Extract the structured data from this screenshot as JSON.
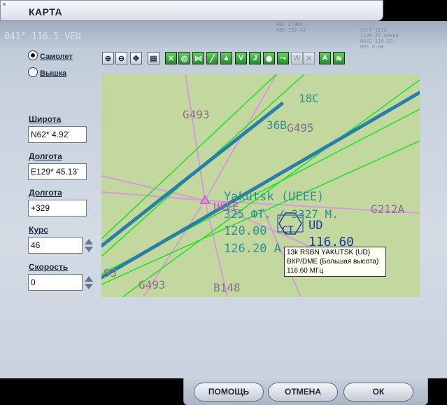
{
  "window": {
    "title": "КАРТА"
  },
  "header_ghost": {
    "left": "041° 116.5 VEN",
    "mid": "ADF 2 MHz\nOBS 132 42",
    "right": "Ctrl 1112\n1125 75 SPEED\nNAV2 110.50\nOBS 0.00"
  },
  "mode": {
    "options": [
      "Самолет",
      "Вышка"
    ],
    "selected": "Самолет"
  },
  "fields": {
    "lat": {
      "label": "Широта",
      "value": "N62* 4.92'"
    },
    "lon": {
      "label": "Долгота",
      "value": "E129* 45.13'"
    },
    "alt": {
      "label": "Долгота",
      "value": "+329"
    },
    "heading": {
      "label": "Курс",
      "value": "46"
    },
    "speed": {
      "label": "Скорость",
      "value": "0"
    }
  },
  "toolbar": [
    "zoom-in",
    "zoom-out",
    "center",
    "print",
    "vor",
    "ndb",
    "ils",
    "airways-low",
    "airways-high",
    "v",
    "j",
    "waypoints",
    "airports",
    "weather",
    "atis",
    "terrain"
  ],
  "map": {
    "labels": {
      "airway_1": "G493",
      "airway_2": "G495",
      "airway_3": "G212A",
      "airway_4": "G493",
      "airway_5": "B148",
      "runway_a": "18C",
      "runway_b": "36B",
      "num_left": "93",
      "airport_name": "Yakutsk (UEEE)",
      "airport_code": "UEEE",
      "elev": "325  ФТ.  / 3327  М.",
      "freq_1": "120.00",
      "freq_2": "126.20  A",
      "vor_code": "UD",
      "vor_freq": "116.60",
      "vor_ct": "CT"
    },
    "tooltip": [
      "13k RSBN YAKUTSK (UD)",
      "ВКР/DME (Большая высота)",
      "116.60 МГц"
    ],
    "colors": {
      "bg": "#c2d89f",
      "airway": "#d99ad9",
      "runway": "#2a7fa6",
      "approach": "#27e02c",
      "text": "#2f8f91",
      "vor": "#1e3d9c"
    }
  },
  "buttons": {
    "help": "ПОМОЩЬ",
    "cancel": "ОТМЕНА",
    "ok": "ОК"
  }
}
